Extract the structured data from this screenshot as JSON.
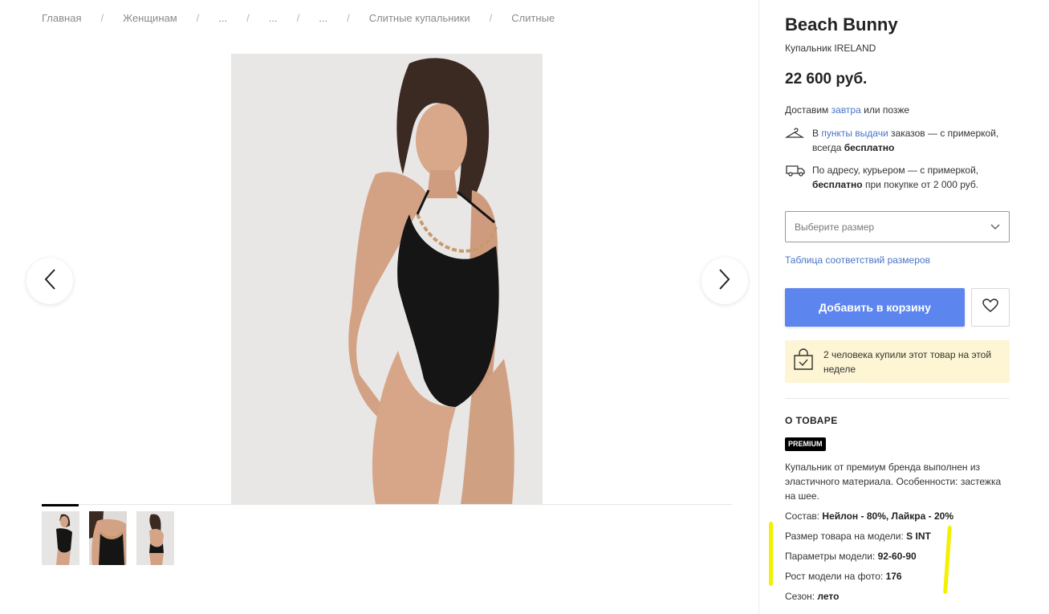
{
  "breadcrumb": {
    "items": [
      "Главная",
      "Женщинам",
      "...",
      "...",
      "...",
      "Слитные купальники",
      "Слитные"
    ],
    "separator": "/"
  },
  "gallery": {
    "prev_icon": "chevron-left-icon",
    "next_icon": "chevron-right-icon",
    "thumbnail_count": 3,
    "active_thumbnail": 1
  },
  "product": {
    "brand": "Beach Bunny",
    "model": "Купальник IRELAND",
    "price": "22 600 руб."
  },
  "delivery": {
    "prefix": "Доставим ",
    "link": "завтра",
    "suffix": " или позже",
    "pickup": {
      "icon": "hanger-icon",
      "pre": "В ",
      "link": "пункты выдачи",
      "rest": " заказов — с примеркой, всегда ",
      "bold": "бесплатно"
    },
    "courier": {
      "icon": "truck-icon",
      "text": "По адресу, курьером — с примеркой, ",
      "bold": "бесплатно",
      "rest": " при покупке от 2 000 руб."
    }
  },
  "size": {
    "placeholder": "Выберите размер",
    "icon": "chevron-down-icon",
    "table_link": "Таблица соответствий размеров"
  },
  "actions": {
    "add_to_cart": "Добавить в корзину",
    "favorite_icon": "heart-icon"
  },
  "notice": {
    "icon": "shopping-bag-check-icon",
    "text": "2 человека купили этот товар на этой неделе"
  },
  "about": {
    "title": "О ТОВАРЕ",
    "badge": "PREMIUM",
    "description": "Купальник от премиум бренда выполнен из эластичного материала. Особенности: застежка на шее.",
    "specs": [
      {
        "label": "Состав: ",
        "value": "Нейлон - 80%, Лайкра - 20%"
      },
      {
        "label": "Размер товара на модели: ",
        "value": "S INT"
      },
      {
        "label": "Параметры модели: ",
        "value": "92-60-90"
      },
      {
        "label": "Рост модели на фото: ",
        "value": "176"
      },
      {
        "label": "Сезон: ",
        "value": "лето"
      }
    ]
  },
  "colors": {
    "accent": "#5c85ee",
    "link": "#4a73c9",
    "notice_bg": "#fdf5d3",
    "highlight": "#f3f000"
  }
}
